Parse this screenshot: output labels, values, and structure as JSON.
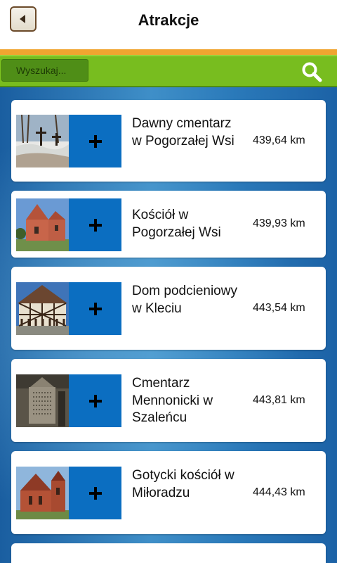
{
  "header": {
    "title": "Atrakcje"
  },
  "search": {
    "placeholder": "Wyszukaj..."
  },
  "colors": {
    "accent_orange": "#f0a530",
    "search_green": "#78bd1f",
    "plus_blue": "#0b6ec1"
  },
  "items": [
    {
      "title": "Dawny cmentarz w Pogorzałej Wsi",
      "distance": "439,64 km",
      "thumb_icon": "cemetery-photo"
    },
    {
      "title": "Kościół w Pogorzałej Wsi",
      "distance": "439,93 km",
      "thumb_icon": "church-photo"
    },
    {
      "title": "Dom podcieniowy w Kleciu",
      "distance": "443,54 km",
      "thumb_icon": "timber-house-photo"
    },
    {
      "title": "Cmentarz Mennonicki w Szaleńcu",
      "distance": "443,81 km",
      "thumb_icon": "gravestone-photo"
    },
    {
      "title": "Gotycki kościół w Miłoradzu",
      "distance": "444,43 km",
      "thumb_icon": "gothic-church-photo"
    }
  ]
}
